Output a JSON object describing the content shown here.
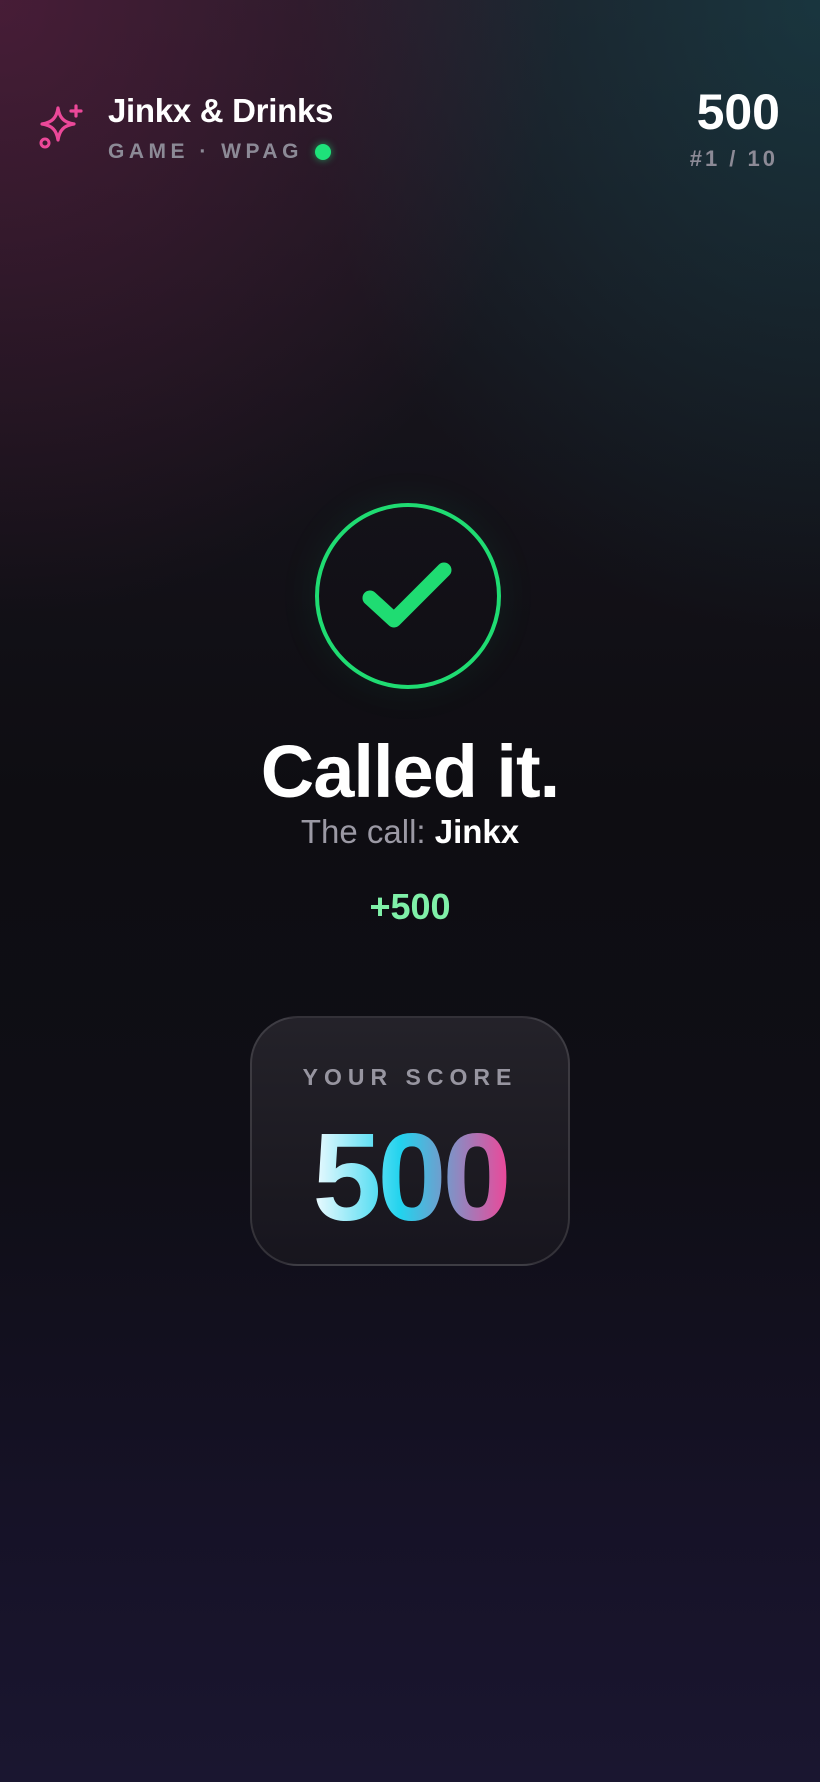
{
  "header": {
    "title": "Jinkx & Drinks",
    "subtitle": "GAME · WPAG",
    "score": "500",
    "rank": "#1 / 10",
    "brand_icon": "sparkle-icon",
    "status_color": "#1ee27a"
  },
  "result": {
    "icon": "checkmark-icon",
    "headline": "Called it.",
    "call_prefix": "The call: ",
    "call_value": "Jinkx",
    "points": "+500",
    "accent_color": "#1fdc72"
  },
  "score_card": {
    "label": "YOUR SCORE",
    "value": "500",
    "gradient": [
      "#f0fbff",
      "#22d3ee",
      "#ec4899"
    ]
  }
}
